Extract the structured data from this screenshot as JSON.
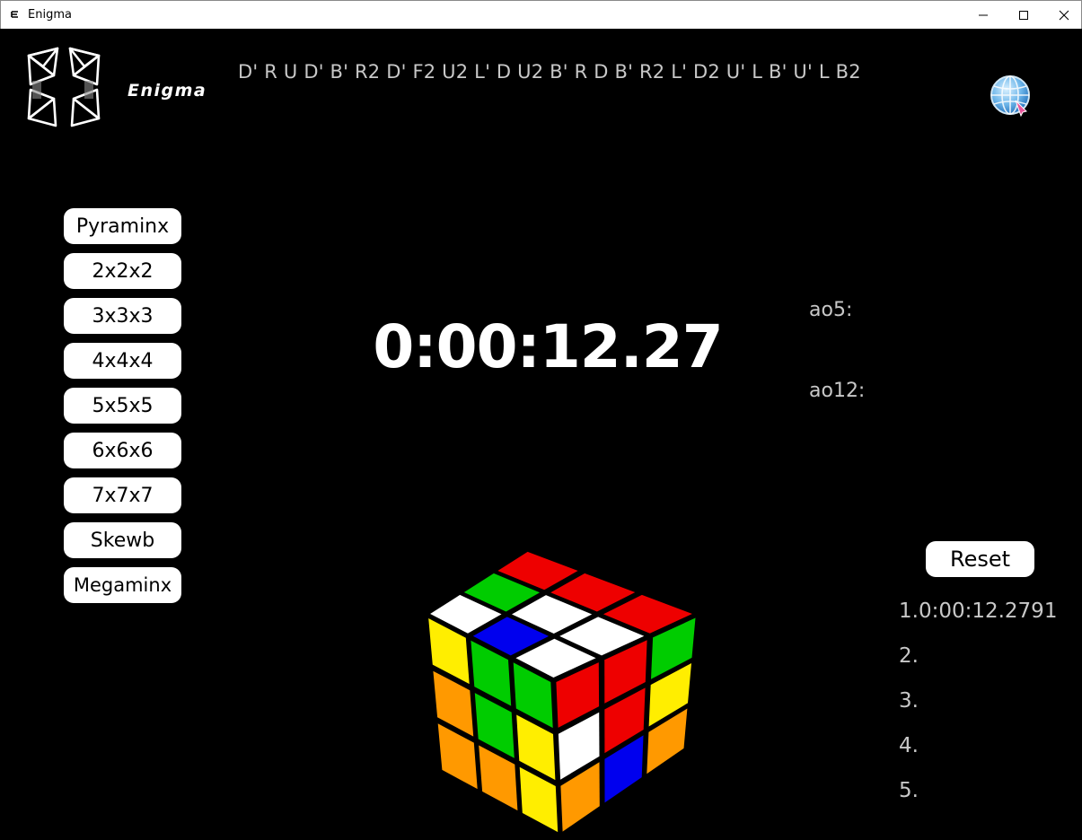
{
  "window": {
    "title": "Enigma",
    "minimize_label": "",
    "maximize_label": "",
    "close_label": ""
  },
  "header": {
    "brand": "Enigma",
    "scramble": "D' R U D' B' R2 D' F2 U2 L' D U2 B' R D B' R2 L' D2 U' L B' U' L B2",
    "globe_icon": "globe-icon"
  },
  "puzzles": [
    {
      "label": "Pyraminx"
    },
    {
      "label": "2x2x2"
    },
    {
      "label": "3x3x3"
    },
    {
      "label": "4x4x4"
    },
    {
      "label": "5x5x5"
    },
    {
      "label": "6x6x6"
    },
    {
      "label": "7x7x7"
    },
    {
      "label": "Skewb"
    },
    {
      "label": "Megaminx"
    }
  ],
  "timer": {
    "display": "0:00:12.27"
  },
  "stats": {
    "ao5_label": "ao5:",
    "ao12_label": "ao12:"
  },
  "reset_label": "Reset",
  "times": [
    {
      "text": "1.0:00:12.2791"
    },
    {
      "text": "2."
    },
    {
      "text": "3."
    },
    {
      "text": "4."
    },
    {
      "text": "5."
    }
  ],
  "colors": {
    "background": "#000000",
    "text_muted": "#c8c8c8",
    "button_bg": "#ffffff",
    "cube_red": "#ee0000",
    "cube_white": "#ffffff",
    "cube_blue": "#0000ee",
    "cube_green": "#00cc00",
    "cube_yellow": "#ffee00",
    "cube_orange": "#ff9900"
  },
  "cube_state": {
    "top": [
      [
        "red",
        "red",
        "red"
      ],
      [
        "green",
        "white",
        "white"
      ],
      [
        "white",
        "blue",
        "white"
      ]
    ],
    "left": [
      [
        "yellow",
        "green",
        "green"
      ],
      [
        "orange",
        "green",
        "yellow"
      ],
      [
        "orange",
        "orange",
        "yellow"
      ]
    ],
    "right": [
      [
        "red",
        "red",
        "green"
      ],
      [
        "white",
        "red",
        "yellow"
      ],
      [
        "orange",
        "blue",
        "orange"
      ]
    ]
  }
}
